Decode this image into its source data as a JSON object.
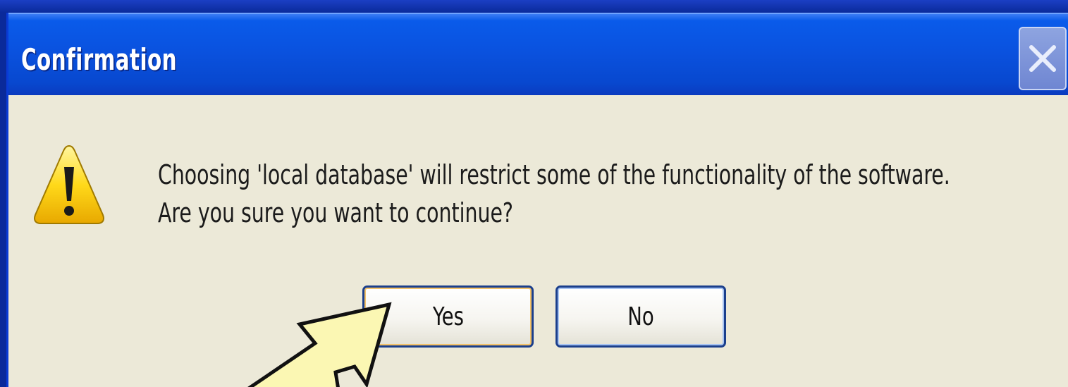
{
  "window": {
    "title": "Confirmation",
    "close_icon": "close-icon"
  },
  "dialog": {
    "icon": "warning-icon",
    "message_line1": "Choosing 'local database' will restrict some of the functionality of the software.",
    "message_line2": "Are you sure you want to continue?",
    "yes_label": "Yes",
    "no_label": "No"
  },
  "annotation": {
    "icon": "arrow-pointer-icon",
    "target": "Yes",
    "color": "#fbf7b3"
  },
  "colors": {
    "titlebar": "#0a52df",
    "dialog_bg": "#ece9d8",
    "desktop_bg": "#0a2a9a"
  }
}
